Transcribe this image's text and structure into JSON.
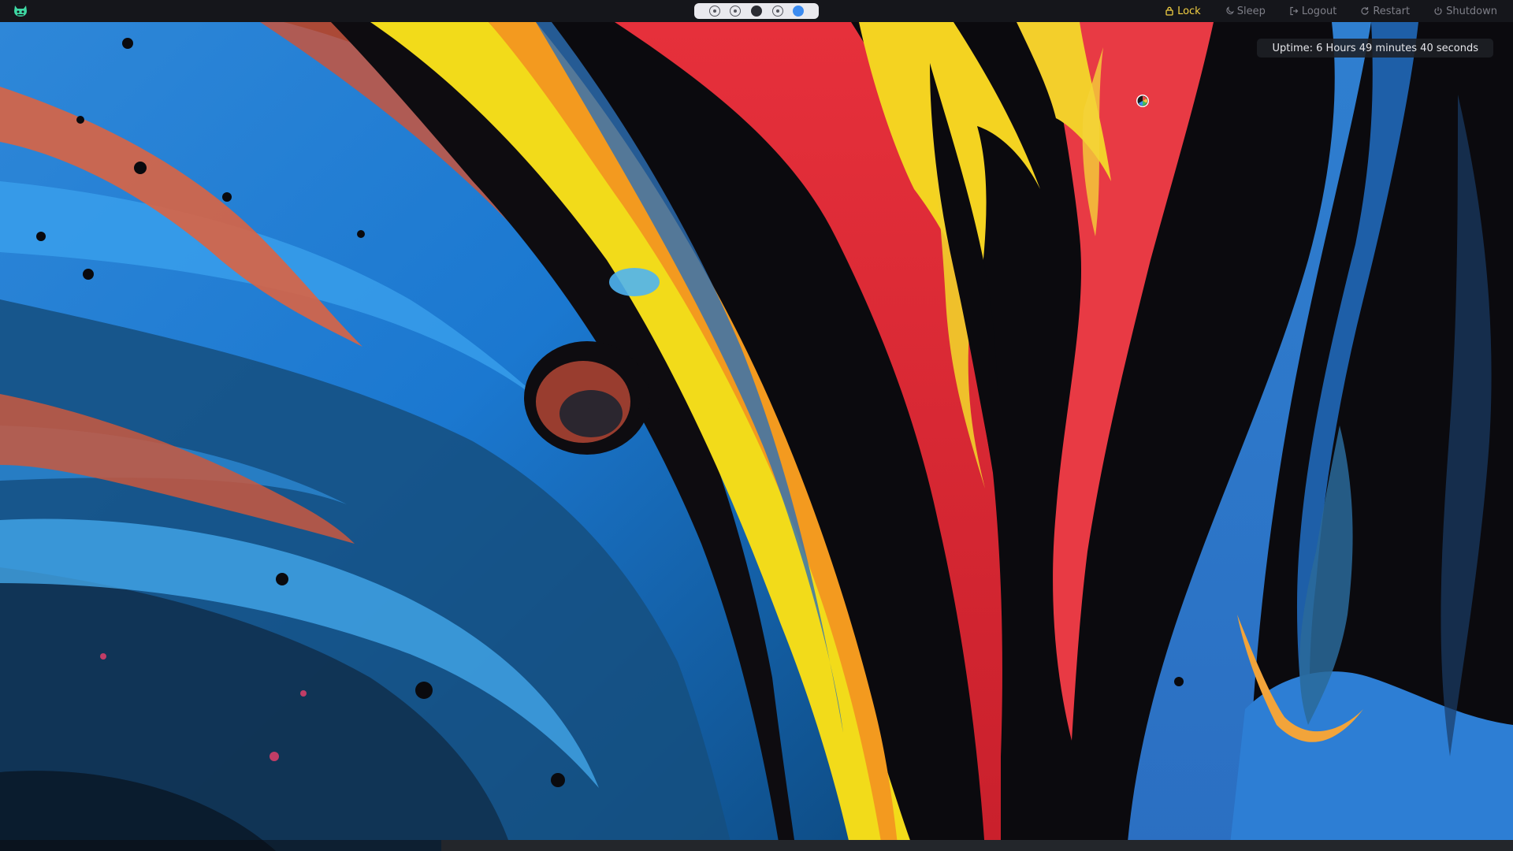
{
  "topbar": {
    "workspaces": [
      {
        "state": "inactive"
      },
      {
        "state": "inactive"
      },
      {
        "state": "occupied"
      },
      {
        "state": "inactive"
      },
      {
        "state": "active"
      }
    ],
    "power_menu": {
      "lock": {
        "label": "Lock",
        "icon": "lock-icon"
      },
      "sleep": {
        "label": "Sleep",
        "icon": "moon-icon"
      },
      "logout": {
        "label": "Logout",
        "icon": "logout-icon"
      },
      "restart": {
        "label": "Restart",
        "icon": "restart-icon"
      },
      "shutdown": {
        "label": "Shutdown",
        "icon": "power-icon"
      }
    }
  },
  "widgets": {
    "uptime": "Uptime: 6 Hours 49 minutes 40 seconds"
  },
  "colors": {
    "bar_background": "#15161b",
    "lock_active": "#f2cf43",
    "power_inactive": "#7e7f88",
    "workspace_active": "#3b8bf0",
    "logo_accent": "#3ed9a4"
  }
}
